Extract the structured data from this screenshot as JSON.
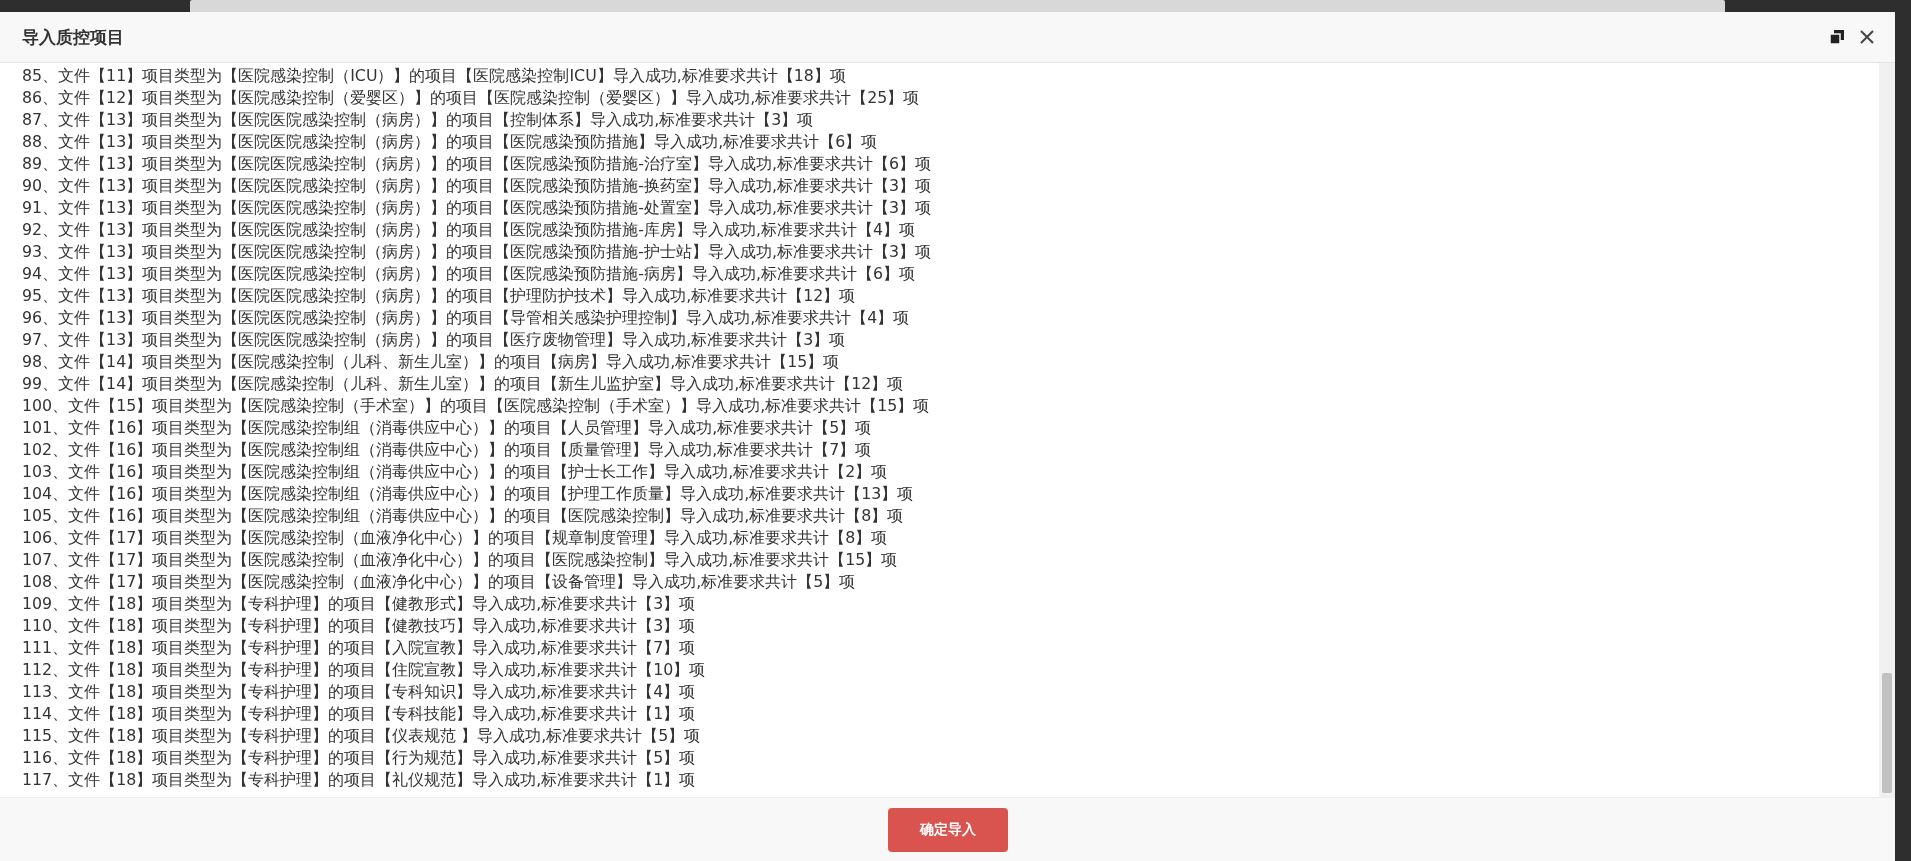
{
  "dialog": {
    "title": "导入质控项目",
    "log_lines": [
      "85、文件【11】项目类型为【医院感染控制（ICU）】的项目【医院感染控制ICU】导入成功,标准要求共计【18】项",
      "86、文件【12】项目类型为【医院感染控制（爱婴区）】的项目【医院感染控制（爱婴区）】导入成功,标准要求共计【25】项",
      "87、文件【13】项目类型为【医院医院感染控制（病房）】的项目【控制体系】导入成功,标准要求共计【3】项",
      "88、文件【13】项目类型为【医院医院感染控制（病房）】的项目【医院感染预防措施】导入成功,标准要求共计【6】项",
      "89、文件【13】项目类型为【医院医院感染控制（病房）】的项目【医院感染预防措施-治疗室】导入成功,标准要求共计【6】项",
      "90、文件【13】项目类型为【医院医院感染控制（病房）】的项目【医院感染预防措施-换药室】导入成功,标准要求共计【3】项",
      "91、文件【13】项目类型为【医院医院感染控制（病房）】的项目【医院感染预防措施-处置室】导入成功,标准要求共计【3】项",
      "92、文件【13】项目类型为【医院医院感染控制（病房）】的项目【医院感染预防措施-库房】导入成功,标准要求共计【4】项",
      "93、文件【13】项目类型为【医院医院感染控制（病房）】的项目【医院感染预防措施-护士站】导入成功,标准要求共计【3】项",
      "94、文件【13】项目类型为【医院医院感染控制（病房）】的项目【医院感染预防措施-病房】导入成功,标准要求共计【6】项",
      "95、文件【13】项目类型为【医院医院感染控制（病房）】的项目【护理防护技术】导入成功,标准要求共计【12】项",
      "96、文件【13】项目类型为【医院医院感染控制（病房）】的项目【导管相关感染护理控制】导入成功,标准要求共计【4】项",
      "97、文件【13】项目类型为【医院医院感染控制（病房）】的项目【医疗废物管理】导入成功,标准要求共计【3】项",
      "98、文件【14】项目类型为【医院感染控制（儿科、新生儿室）】的项目【病房】导入成功,标准要求共计【15】项",
      "99、文件【14】项目类型为【医院感染控制（儿科、新生儿室）】的项目【新生儿监护室】导入成功,标准要求共计【12】项",
      "100、文件【15】项目类型为【医院感染控制（手术室）】的项目【医院感染控制（手术室）】导入成功,标准要求共计【15】项",
      "101、文件【16】项目类型为【医院感染控制组（消毒供应中心）】的项目【人员管理】导入成功,标准要求共计【5】项",
      "102、文件【16】项目类型为【医院感染控制组（消毒供应中心）】的项目【质量管理】导入成功,标准要求共计【7】项",
      "103、文件【16】项目类型为【医院感染控制组（消毒供应中心）】的项目【护士长工作】导入成功,标准要求共计【2】项",
      "104、文件【16】项目类型为【医院感染控制组（消毒供应中心）】的项目【护理工作质量】导入成功,标准要求共计【13】项",
      "105、文件【16】项目类型为【医院感染控制组（消毒供应中心）】的项目【医院感染控制】导入成功,标准要求共计【8】项",
      "106、文件【17】项目类型为【医院感染控制（血液净化中心）】的项目【规章制度管理】导入成功,标准要求共计【8】项",
      "107、文件【17】项目类型为【医院感染控制（血液净化中心）】的项目【医院感染控制】导入成功,标准要求共计【15】项",
      "108、文件【17】项目类型为【医院感染控制（血液净化中心）】的项目【设备管理】导入成功,标准要求共计【5】项",
      "109、文件【18】项目类型为【专科护理】的项目【健教形式】导入成功,标准要求共计【3】项",
      "110、文件【18】项目类型为【专科护理】的项目【健教技巧】导入成功,标准要求共计【3】项",
      "111、文件【18】项目类型为【专科护理】的项目【入院宣教】导入成功,标准要求共计【7】项",
      "112、文件【18】项目类型为【专科护理】的项目【住院宣教】导入成功,标准要求共计【10】项",
      "113、文件【18】项目类型为【专科护理】的项目【专科知识】导入成功,标准要求共计【4】项",
      "114、文件【18】项目类型为【专科护理】的项目【专科技能】导入成功,标准要求共计【1】项",
      "115、文件【18】项目类型为【专科护理】的项目【仪表规范 】导入成功,标准要求共计【5】项",
      "116、文件【18】项目类型为【专科护理】的项目【行为规范】导入成功,标准要求共计【5】项",
      "117、文件【18】项目类型为【专科护理】的项目【礼仪规范】导入成功,标准要求共计【1】项"
    ],
    "confirm_button": "确定导入"
  }
}
